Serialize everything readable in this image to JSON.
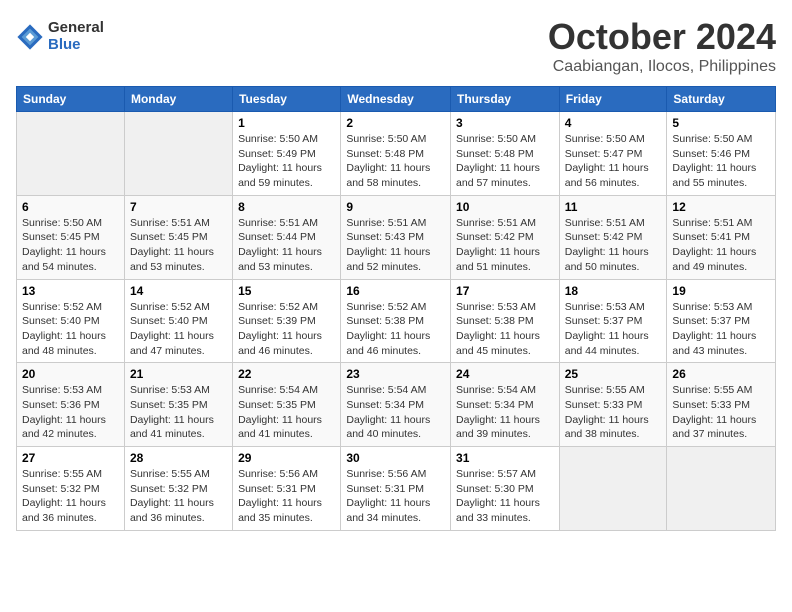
{
  "logo": {
    "general": "General",
    "blue": "Blue"
  },
  "title": "October 2024",
  "location": "Caabiangan, Ilocos, Philippines",
  "days_of_week": [
    "Sunday",
    "Monday",
    "Tuesday",
    "Wednesday",
    "Thursday",
    "Friday",
    "Saturday"
  ],
  "weeks": [
    [
      {
        "day": "",
        "sunrise": "",
        "sunset": "",
        "daylight": ""
      },
      {
        "day": "",
        "sunrise": "",
        "sunset": "",
        "daylight": ""
      },
      {
        "day": "1",
        "sunrise": "Sunrise: 5:50 AM",
        "sunset": "Sunset: 5:49 PM",
        "daylight": "Daylight: 11 hours and 59 minutes."
      },
      {
        "day": "2",
        "sunrise": "Sunrise: 5:50 AM",
        "sunset": "Sunset: 5:48 PM",
        "daylight": "Daylight: 11 hours and 58 minutes."
      },
      {
        "day": "3",
        "sunrise": "Sunrise: 5:50 AM",
        "sunset": "Sunset: 5:48 PM",
        "daylight": "Daylight: 11 hours and 57 minutes."
      },
      {
        "day": "4",
        "sunrise": "Sunrise: 5:50 AM",
        "sunset": "Sunset: 5:47 PM",
        "daylight": "Daylight: 11 hours and 56 minutes."
      },
      {
        "day": "5",
        "sunrise": "Sunrise: 5:50 AM",
        "sunset": "Sunset: 5:46 PM",
        "daylight": "Daylight: 11 hours and 55 minutes."
      }
    ],
    [
      {
        "day": "6",
        "sunrise": "Sunrise: 5:50 AM",
        "sunset": "Sunset: 5:45 PM",
        "daylight": "Daylight: 11 hours and 54 minutes."
      },
      {
        "day": "7",
        "sunrise": "Sunrise: 5:51 AM",
        "sunset": "Sunset: 5:45 PM",
        "daylight": "Daylight: 11 hours and 53 minutes."
      },
      {
        "day": "8",
        "sunrise": "Sunrise: 5:51 AM",
        "sunset": "Sunset: 5:44 PM",
        "daylight": "Daylight: 11 hours and 53 minutes."
      },
      {
        "day": "9",
        "sunrise": "Sunrise: 5:51 AM",
        "sunset": "Sunset: 5:43 PM",
        "daylight": "Daylight: 11 hours and 52 minutes."
      },
      {
        "day": "10",
        "sunrise": "Sunrise: 5:51 AM",
        "sunset": "Sunset: 5:42 PM",
        "daylight": "Daylight: 11 hours and 51 minutes."
      },
      {
        "day": "11",
        "sunrise": "Sunrise: 5:51 AM",
        "sunset": "Sunset: 5:42 PM",
        "daylight": "Daylight: 11 hours and 50 minutes."
      },
      {
        "day": "12",
        "sunrise": "Sunrise: 5:51 AM",
        "sunset": "Sunset: 5:41 PM",
        "daylight": "Daylight: 11 hours and 49 minutes."
      }
    ],
    [
      {
        "day": "13",
        "sunrise": "Sunrise: 5:52 AM",
        "sunset": "Sunset: 5:40 PM",
        "daylight": "Daylight: 11 hours and 48 minutes."
      },
      {
        "day": "14",
        "sunrise": "Sunrise: 5:52 AM",
        "sunset": "Sunset: 5:40 PM",
        "daylight": "Daylight: 11 hours and 47 minutes."
      },
      {
        "day": "15",
        "sunrise": "Sunrise: 5:52 AM",
        "sunset": "Sunset: 5:39 PM",
        "daylight": "Daylight: 11 hours and 46 minutes."
      },
      {
        "day": "16",
        "sunrise": "Sunrise: 5:52 AM",
        "sunset": "Sunset: 5:38 PM",
        "daylight": "Daylight: 11 hours and 46 minutes."
      },
      {
        "day": "17",
        "sunrise": "Sunrise: 5:53 AM",
        "sunset": "Sunset: 5:38 PM",
        "daylight": "Daylight: 11 hours and 45 minutes."
      },
      {
        "day": "18",
        "sunrise": "Sunrise: 5:53 AM",
        "sunset": "Sunset: 5:37 PM",
        "daylight": "Daylight: 11 hours and 44 minutes."
      },
      {
        "day": "19",
        "sunrise": "Sunrise: 5:53 AM",
        "sunset": "Sunset: 5:37 PM",
        "daylight": "Daylight: 11 hours and 43 minutes."
      }
    ],
    [
      {
        "day": "20",
        "sunrise": "Sunrise: 5:53 AM",
        "sunset": "Sunset: 5:36 PM",
        "daylight": "Daylight: 11 hours and 42 minutes."
      },
      {
        "day": "21",
        "sunrise": "Sunrise: 5:53 AM",
        "sunset": "Sunset: 5:35 PM",
        "daylight": "Daylight: 11 hours and 41 minutes."
      },
      {
        "day": "22",
        "sunrise": "Sunrise: 5:54 AM",
        "sunset": "Sunset: 5:35 PM",
        "daylight": "Daylight: 11 hours and 41 minutes."
      },
      {
        "day": "23",
        "sunrise": "Sunrise: 5:54 AM",
        "sunset": "Sunset: 5:34 PM",
        "daylight": "Daylight: 11 hours and 40 minutes."
      },
      {
        "day": "24",
        "sunrise": "Sunrise: 5:54 AM",
        "sunset": "Sunset: 5:34 PM",
        "daylight": "Daylight: 11 hours and 39 minutes."
      },
      {
        "day": "25",
        "sunrise": "Sunrise: 5:55 AM",
        "sunset": "Sunset: 5:33 PM",
        "daylight": "Daylight: 11 hours and 38 minutes."
      },
      {
        "day": "26",
        "sunrise": "Sunrise: 5:55 AM",
        "sunset": "Sunset: 5:33 PM",
        "daylight": "Daylight: 11 hours and 37 minutes."
      }
    ],
    [
      {
        "day": "27",
        "sunrise": "Sunrise: 5:55 AM",
        "sunset": "Sunset: 5:32 PM",
        "daylight": "Daylight: 11 hours and 36 minutes."
      },
      {
        "day": "28",
        "sunrise": "Sunrise: 5:55 AM",
        "sunset": "Sunset: 5:32 PM",
        "daylight": "Daylight: 11 hours and 36 minutes."
      },
      {
        "day": "29",
        "sunrise": "Sunrise: 5:56 AM",
        "sunset": "Sunset: 5:31 PM",
        "daylight": "Daylight: 11 hours and 35 minutes."
      },
      {
        "day": "30",
        "sunrise": "Sunrise: 5:56 AM",
        "sunset": "Sunset: 5:31 PM",
        "daylight": "Daylight: 11 hours and 34 minutes."
      },
      {
        "day": "31",
        "sunrise": "Sunrise: 5:57 AM",
        "sunset": "Sunset: 5:30 PM",
        "daylight": "Daylight: 11 hours and 33 minutes."
      },
      {
        "day": "",
        "sunrise": "",
        "sunset": "",
        "daylight": ""
      },
      {
        "day": "",
        "sunrise": "",
        "sunset": "",
        "daylight": ""
      }
    ]
  ]
}
